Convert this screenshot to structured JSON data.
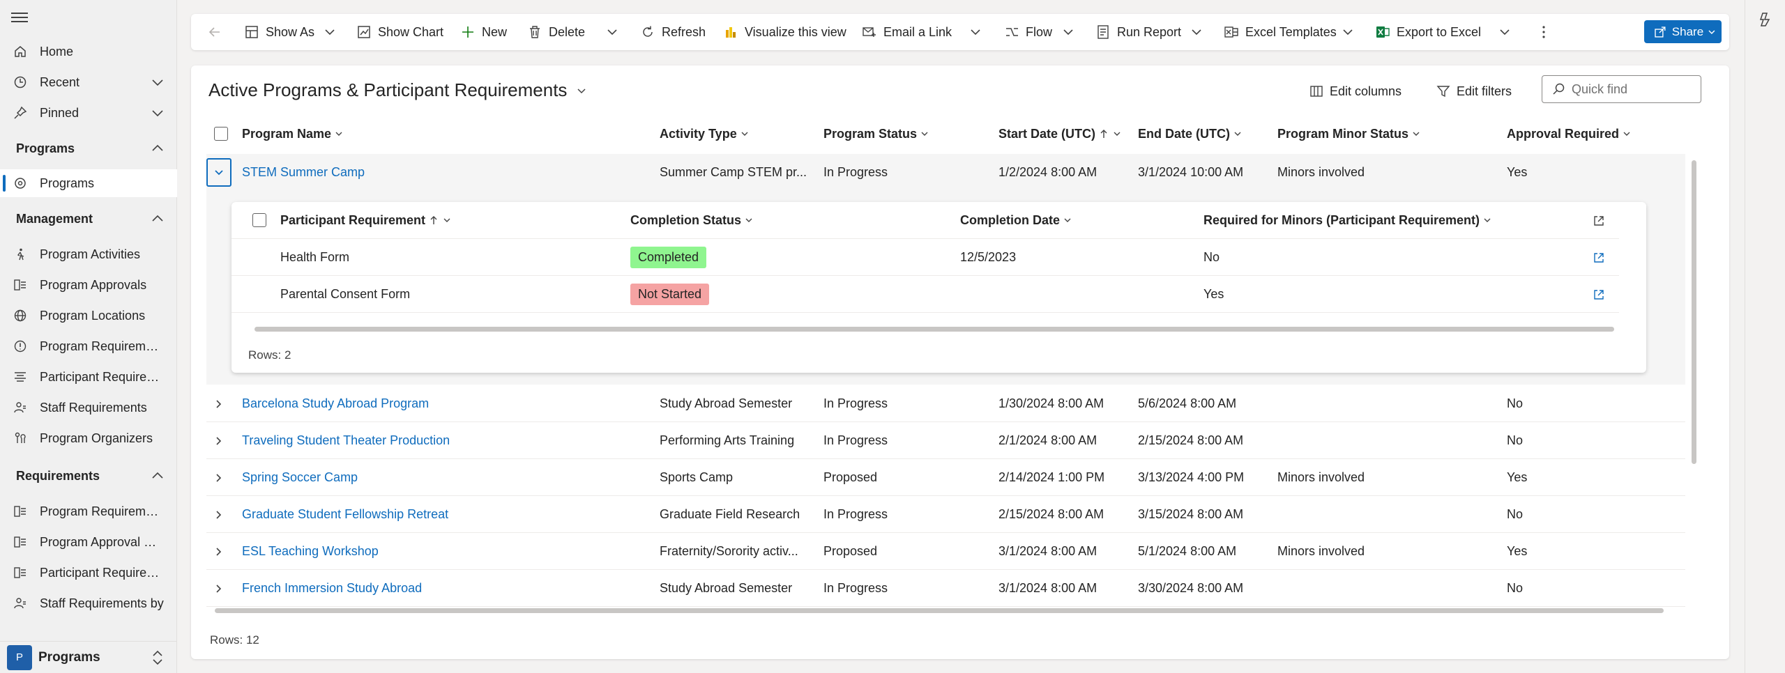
{
  "sidebar": {
    "nav": [
      {
        "label": "Home",
        "icon": "home-icon"
      },
      {
        "label": "Recent",
        "icon": "clock-icon"
      },
      {
        "label": "Pinned",
        "icon": "pin-icon"
      }
    ],
    "groups": [
      {
        "label": "Programs",
        "items": [
          {
            "label": "Programs",
            "icon": "program-icon",
            "selected": true
          }
        ]
      },
      {
        "label": "Management",
        "items": [
          {
            "label": "Program Activities",
            "icon": "walking-icon"
          },
          {
            "label": "Program Approvals",
            "icon": "approvals-icon"
          },
          {
            "label": "Program Locations",
            "icon": "globe-icon"
          },
          {
            "label": "Program Requirements",
            "icon": "requirements-icon"
          },
          {
            "label": "Participant Requirements",
            "icon": "checklist-icon"
          },
          {
            "label": "Staff Requirements",
            "icon": "staff-icon"
          },
          {
            "label": "Program Organizers",
            "icon": "organizer-icon"
          }
        ]
      },
      {
        "label": "Requirements",
        "items": [
          {
            "label": "Program Requirements",
            "icon": "requirements-icon"
          },
          {
            "label": "Program Approval Options",
            "icon": "approvals-icon"
          },
          {
            "label": "Participant Requirements",
            "icon": "approvals-icon"
          },
          {
            "label": "Staff Requirements by",
            "icon": "staff-icon"
          }
        ]
      }
    ],
    "area": {
      "badge": "P",
      "label": "Programs"
    }
  },
  "commands": {
    "show_as": "Show As",
    "show_chart": "Show Chart",
    "new": "New",
    "delete": "Delete",
    "refresh": "Refresh",
    "visualize": "Visualize this view",
    "email_link": "Email a Link",
    "flow": "Flow",
    "run_report": "Run Report",
    "excel_templates": "Excel Templates",
    "export_excel": "Export to Excel",
    "share": "Share"
  },
  "view": {
    "title": "Active Programs & Participant Requirements",
    "edit_columns": "Edit columns",
    "edit_filters": "Edit filters",
    "quick_find_placeholder": "Quick find"
  },
  "grid": {
    "columns": [
      "Program Name",
      "Activity Type",
      "Program Status",
      "Start Date (UTC)",
      "End Date (UTC)",
      "Program Minor Status",
      "Approval Required"
    ],
    "rows": [
      {
        "name": "STEM Summer Camp",
        "activity": "Summer Camp STEM pr...",
        "status": "In Progress",
        "start": "1/2/2024 8:00 AM",
        "end": "3/1/2024 10:00 AM",
        "minor": "Minors involved",
        "approval": "Yes"
      },
      {
        "name": "Barcelona Study Abroad Program",
        "activity": "Study Abroad Semester",
        "status": "In Progress",
        "start": "1/30/2024 8:00 AM",
        "end": "5/6/2024 8:00 AM",
        "minor": "",
        "approval": "No"
      },
      {
        "name": "Traveling Student Theater Production",
        "activity": "Performing Arts Training",
        "status": "In Progress",
        "start": "2/1/2024 8:00 AM",
        "end": "2/15/2024 8:00 AM",
        "minor": "",
        "approval": "No"
      },
      {
        "name": "Spring Soccer Camp",
        "activity": "Sports Camp",
        "status": "Proposed",
        "start": "2/14/2024 1:00 PM",
        "end": "3/13/2024 4:00 PM",
        "minor": "Minors involved",
        "approval": "Yes"
      },
      {
        "name": "Graduate Student Fellowship Retreat",
        "activity": "Graduate Field Research",
        "status": "In Progress",
        "start": "2/15/2024 8:00 AM",
        "end": "3/15/2024 8:00 AM",
        "minor": "",
        "approval": "No"
      },
      {
        "name": "ESL Teaching Workshop",
        "activity": "Fraternity/Sorority activ...",
        "status": "Proposed",
        "start": "3/1/2024 8:00 AM",
        "end": "5/1/2024 8:00 AM",
        "minor": "Minors involved",
        "approval": "Yes"
      },
      {
        "name": "French Immersion Study Abroad",
        "activity": "Study Abroad Semester",
        "status": "In Progress",
        "start": "3/1/2024 8:00 AM",
        "end": "3/30/2024 8:00 AM",
        "minor": "",
        "approval": "No"
      }
    ],
    "footer": "Rows: 12"
  },
  "subgrid": {
    "columns": [
      "Participant Requirement",
      "Completion Status",
      "Completion Date",
      "Required for Minors (Participant Requirement)"
    ],
    "rows": [
      {
        "req": "Health Form",
        "status": "Completed",
        "status_color": "#8ff58f",
        "date": "12/5/2023",
        "minors": "No"
      },
      {
        "req": "Parental Consent Form",
        "status": "Not Started",
        "status_color": "#f5a3a3",
        "date": "",
        "minors": "Yes"
      }
    ],
    "footer": "Rows: 2"
  }
}
